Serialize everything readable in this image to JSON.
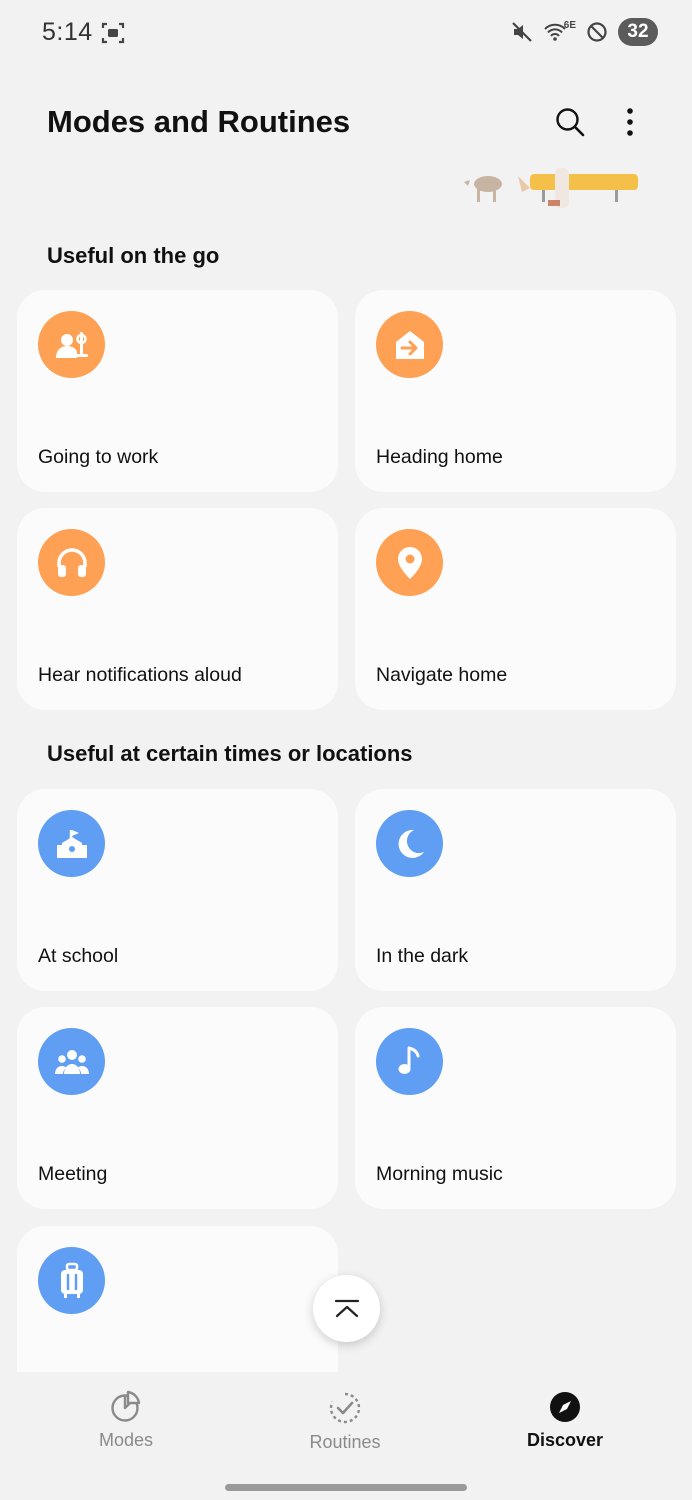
{
  "status_bar": {
    "time": "5:14",
    "network_label": "6E",
    "battery": "32"
  },
  "header": {
    "title": "Modes and Routines",
    "search_icon": "search-icon",
    "more_icon": "more-vertical-icon"
  },
  "sections": [
    {
      "title": "Useful on the go",
      "cards": [
        {
          "label": "Going to work",
          "icon": "commute-icon",
          "color": "#ffa154"
        },
        {
          "label": "Heading home",
          "icon": "home-arrow-icon",
          "color": "#ffa154"
        },
        {
          "label": "Hear notifications aloud",
          "icon": "headphones-icon",
          "color": "#ffa154"
        },
        {
          "label": "Navigate home",
          "icon": "location-pin-icon",
          "color": "#ffa154"
        }
      ]
    },
    {
      "title": "Useful at certain times or locations",
      "cards": [
        {
          "label": "At school",
          "icon": "school-icon",
          "color": "#5f9ef2"
        },
        {
          "label": "In the dark",
          "icon": "moon-icon",
          "color": "#5f9ef2"
        },
        {
          "label": "Meeting",
          "icon": "people-icon",
          "color": "#5f9ef2"
        },
        {
          "label": "Morning music",
          "icon": "music-note-icon",
          "color": "#5f9ef2"
        },
        {
          "label": "",
          "icon": "luggage-icon",
          "color": "#5f9ef2"
        }
      ]
    }
  ],
  "bottom_nav": {
    "items": [
      {
        "label": "Modes",
        "icon": "modes-icon",
        "active": false
      },
      {
        "label": "Routines",
        "icon": "routines-icon",
        "active": false
      },
      {
        "label": "Discover",
        "icon": "discover-icon",
        "active": true
      }
    ]
  }
}
